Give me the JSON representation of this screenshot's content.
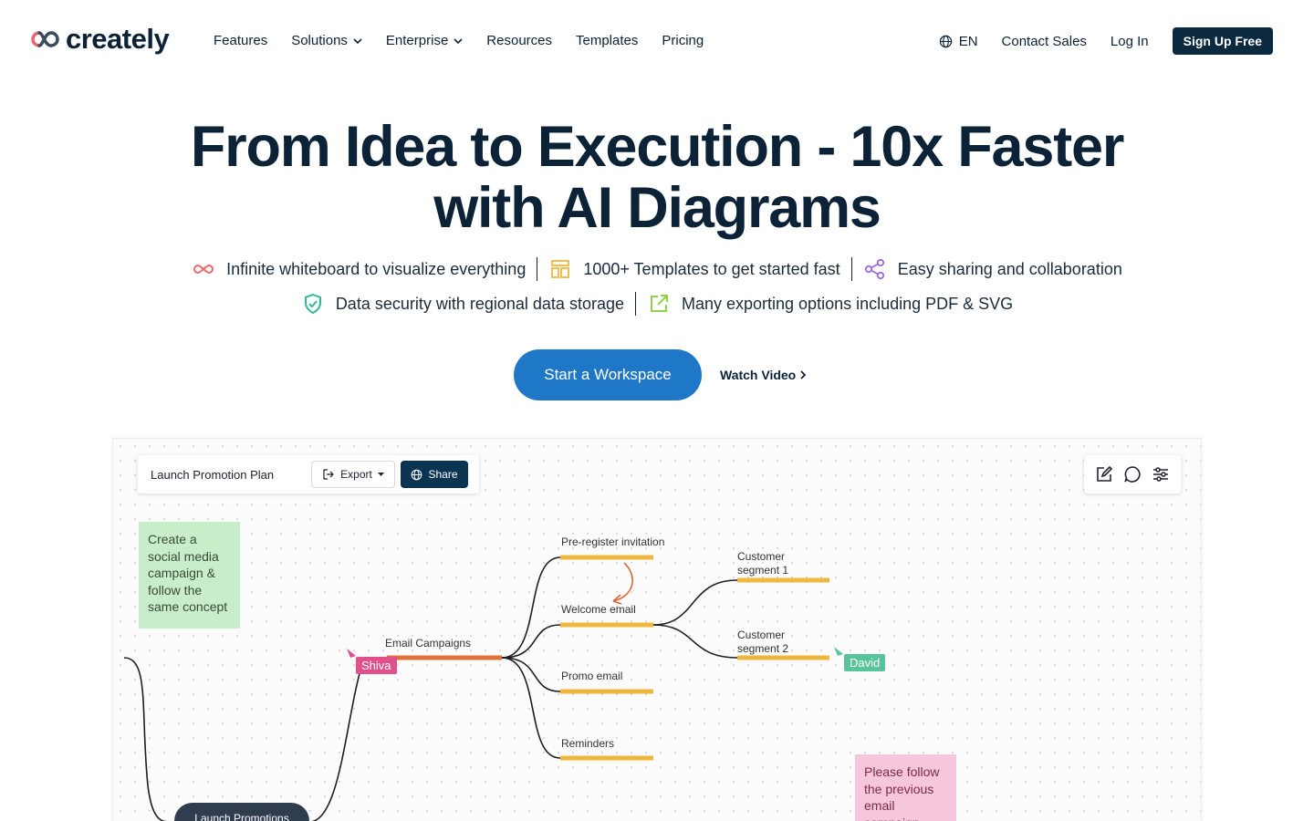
{
  "nav": {
    "logo_text": "creately",
    "menu": [
      {
        "label": "Features",
        "dropdown": false
      },
      {
        "label": "Solutions",
        "dropdown": true
      },
      {
        "label": "Enterprise",
        "dropdown": true
      },
      {
        "label": "Resources",
        "dropdown": false
      },
      {
        "label": "Templates",
        "dropdown": false
      },
      {
        "label": "Pricing",
        "dropdown": false
      }
    ],
    "language": "EN",
    "contact_sales": "Contact Sales",
    "login": "Log In",
    "signup": "Sign Up Free"
  },
  "hero": {
    "title_line1": "From Idea to Execution - 10x Faster",
    "title_line2": "with AI Diagrams",
    "features": [
      {
        "icon": "infinity-icon",
        "text": "Infinite whiteboard to visualize everything"
      },
      {
        "icon": "templates-icon",
        "text": "1000+ Templates to get started fast"
      },
      {
        "icon": "share-nodes-icon",
        "text": "Easy sharing and collaboration"
      },
      {
        "icon": "shield-check-icon",
        "text": "Data security with regional data storage"
      },
      {
        "icon": "export-icon",
        "text": "Many exporting options including PDF & SVG"
      }
    ],
    "cta": "Start a Workspace",
    "watch_video": "Watch Video"
  },
  "canvas": {
    "doc_title": "Launch Promotion Plan",
    "export_label": "Export",
    "share_label": "Share",
    "sticky_green": "Create a social media campaign & follow the same concept",
    "sticky_pink": "Please follow the previous email campaign",
    "nodes": {
      "email_campaigns": "Email Campaigns",
      "pre_register": "Pre-register invitation",
      "welcome_email": "Welcome email",
      "promo_email": "Promo email",
      "reminders": "Reminders",
      "segment1_line1": "Customer",
      "segment1_line2": "segment 1",
      "segment2_line1": "Customer",
      "segment2_line2": "segment 2",
      "root": "Launch Promotions"
    },
    "cursors": {
      "shiva": "Shiva",
      "david": "David"
    }
  },
  "colors": {
    "brand_dark": "#0b2237",
    "cta_blue": "#1f78c7",
    "branch_orange": "#f0b73f",
    "branch_red": "#e0703a"
  }
}
